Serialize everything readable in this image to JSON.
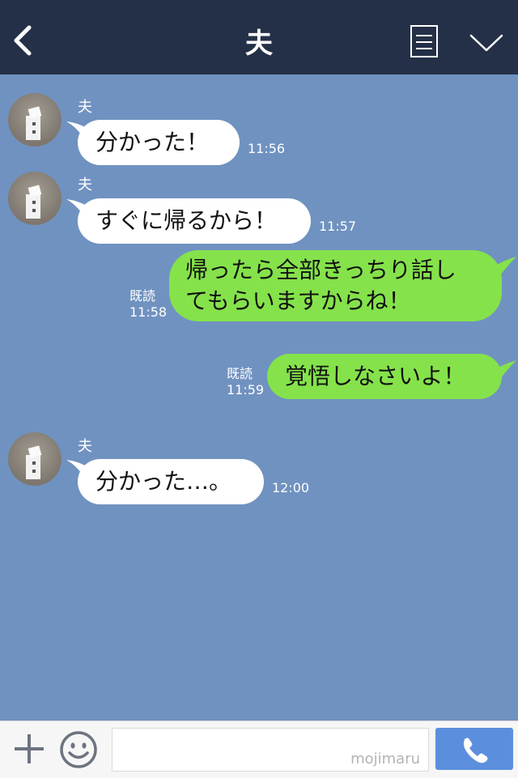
{
  "header": {
    "title": "夫"
  },
  "messages": [
    {
      "sender": "夫",
      "text": "分かった！",
      "time": "11:56"
    },
    {
      "sender": "夫",
      "text": "すぐに帰るから！",
      "time": "11:57"
    },
    {
      "line1": "帰ったら全部きっちり話し",
      "line2": "てもらいますからね！",
      "read": "既読",
      "time": "11:58"
    },
    {
      "text": "覚悟しなさいよ！",
      "read": "既読",
      "time": "11:59"
    },
    {
      "sender": "夫",
      "text": "分かった…。",
      "time": "12:00"
    }
  ],
  "input": {
    "watermark": "mojimaru"
  },
  "colors": {
    "header_bg": "#243047",
    "chat_bg": "#7092c0",
    "outgoing_bubble": "#85e24b",
    "incoming_bubble": "#ffffff",
    "call_button": "#5b8fde"
  },
  "icons": [
    "back-icon",
    "note-icon",
    "chevron-down-icon",
    "plus-icon",
    "emoji-icon",
    "phone-icon"
  ]
}
